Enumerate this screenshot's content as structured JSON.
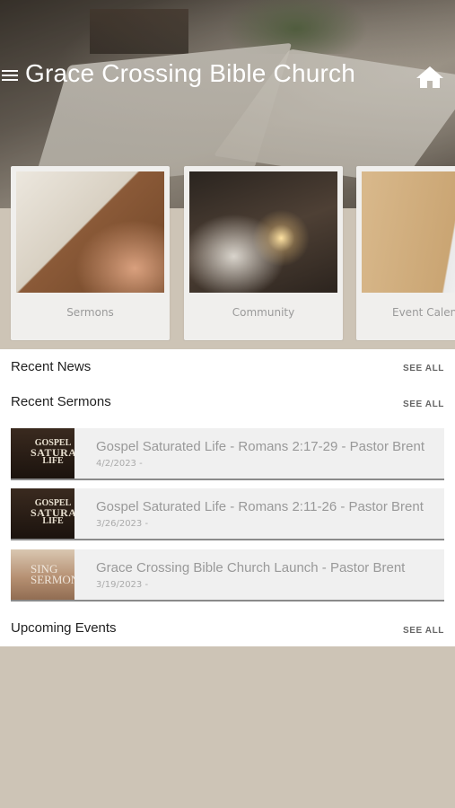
{
  "header": {
    "title": "Grace Crossing Bible Church",
    "menu_icon": "hamburger-icon",
    "home_icon": "home-icon"
  },
  "categories": [
    {
      "label": "Sermons"
    },
    {
      "label": "Community"
    },
    {
      "label": "Event Calendar"
    }
  ],
  "sections": {
    "recent_news": {
      "title": "Recent News",
      "see_all": "SEE ALL"
    },
    "recent_sermons": {
      "title": "Recent Sermons",
      "see_all": "SEE ALL"
    },
    "upcoming_events": {
      "title": "Upcoming Events",
      "see_all": "SEE ALL"
    }
  },
  "sermons": [
    {
      "title": "Gospel Saturated Life - Romans 2:17-29 - Pastor Brent",
      "date": "4/2/2023 -",
      "thumb_text": [
        "GOSPEL",
        "SATURATED",
        "LIFE"
      ]
    },
    {
      "title": "Gospel Saturated Life - Romans 2:11-26 - Pastor Brent",
      "date": "3/26/2023 -",
      "thumb_text": [
        "GOSPEL",
        "SATURATED",
        "LIFE"
      ]
    },
    {
      "title": "Grace Crossing Bible Church Launch - Pastor Brent",
      "date": "3/19/2023 -",
      "thumb_text": [
        "SING",
        "SERMON"
      ]
    }
  ],
  "colors": {
    "background": "#cdc4b6",
    "panel": "#ffffff",
    "card": "#f0efed",
    "row_border": "#8a8a8a"
  }
}
